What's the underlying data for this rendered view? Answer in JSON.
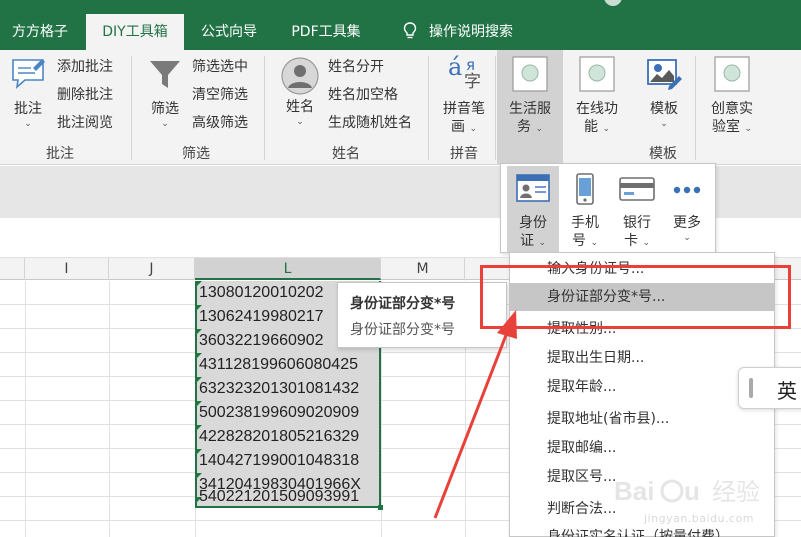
{
  "app": {
    "tabs": [
      {
        "label": "方方格子",
        "active": false
      },
      {
        "label": "DIY工具箱",
        "active": true
      },
      {
        "label": "公式向导",
        "active": false
      },
      {
        "label": "PDF工具集",
        "active": false
      },
      {
        "label": "操作说明搜索",
        "active": false,
        "icon": "lightbulb-icon"
      }
    ]
  },
  "ribbon": {
    "groups": {
      "comment": {
        "label": "批注",
        "big_button": {
          "label": "批注",
          "icon": "comment-icon"
        },
        "items": [
          "添加批注",
          "删除批注",
          "批注阅览"
        ]
      },
      "filter": {
        "label": "筛选",
        "big_button": {
          "label": "筛选",
          "icon": "funnel-icon"
        },
        "items": [
          "筛选选中",
          "清空筛选",
          "高级筛选"
        ]
      },
      "name": {
        "label": "姓名",
        "big_button": {
          "label": "姓名",
          "icon": "person-icon"
        },
        "items": [
          "姓名分开",
          "姓名加空格",
          "生成随机姓名"
        ]
      },
      "pinyin": {
        "label": "拼音",
        "big_button": {
          "label_line1": "拼音笔",
          "label_line2": "画",
          "icon": "pinyin-icon",
          "icon_text": "á",
          "icon_text_2": "я",
          "icon_text_3": "字"
        }
      },
      "template": {
        "label": "模板",
        "buttons": [
          {
            "label_line1": "生活服",
            "label_line2": "务",
            "icon": "circle-placeholder-icon",
            "pressed": true
          },
          {
            "label_line1": "在线功",
            "label_line2": "能",
            "icon": "circle-placeholder-icon",
            "pressed": false
          },
          {
            "label_line1": "模板",
            "label_line2": "",
            "icon": "picture-edit-icon",
            "pressed": false
          },
          {
            "label_line1": "创意实",
            "label_line2": "验室",
            "icon": "circle-placeholder-icon",
            "pressed": false
          }
        ]
      }
    }
  },
  "sheet": {
    "columns": [
      "I",
      "J",
      "L",
      "M"
    ],
    "selected_column": "L",
    "cells_L": [
      "13080120010202",
      "13062419980217",
      "36032219660902",
      "431128199606080425",
      "632323201301081432",
      "500238199609020909",
      "422828201805216329",
      "140427199001048318",
      "34120419830401966X",
      "540221201509093991"
    ]
  },
  "tooltip": {
    "title": "身份证部分变*号",
    "description": "身份证部分变*号"
  },
  "submenu": {
    "buttons": [
      {
        "label_line1": "身份",
        "label_line2": "证",
        "icon": "id-card-icon",
        "active": true
      },
      {
        "label_line1": "手机",
        "label_line2": "号",
        "icon": "phone-icon",
        "active": false
      },
      {
        "label_line1": "银行",
        "label_line2": "卡",
        "icon": "bank-card-icon",
        "active": false
      },
      {
        "label_line1": "更多",
        "label_line2": "",
        "icon": "more-dots-icon",
        "active": false
      }
    ]
  },
  "menu": {
    "items": [
      "输入身份证号...",
      "身份证部分变*号...",
      "提取性别...",
      "提取出生日期...",
      "提取年龄...",
      "提取地址(省市县)...",
      "提取邮编...",
      "提取区号...",
      "判断合法...",
      "身份证实名认证（按量付费）"
    ],
    "hovered_index": 1
  },
  "ime": {
    "label": "英"
  },
  "watermark": {
    "logo": "Baidu 经验",
    "url": "jingyan.baidu.com"
  },
  "colors": {
    "excel_green": "#217346",
    "annotation_red": "#e8413a",
    "selection_gray": "#d9d9d9"
  }
}
